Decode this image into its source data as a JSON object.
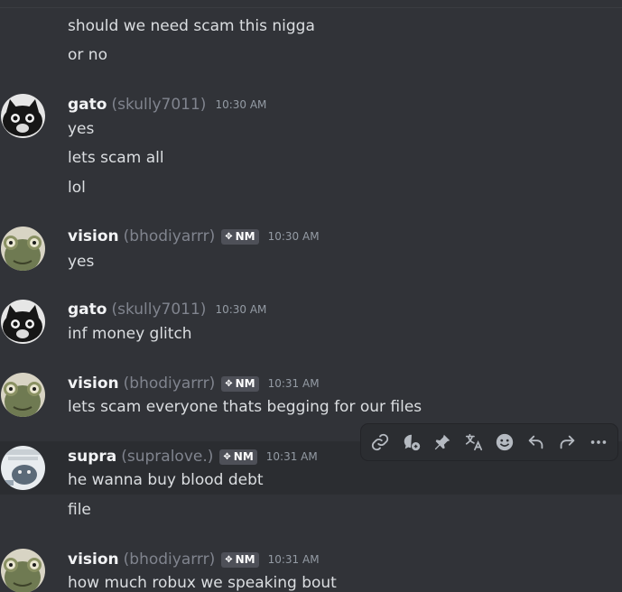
{
  "messages": {
    "m0": {
      "lines": [
        "should we need scam this nigga",
        "or no"
      ]
    },
    "m1": {
      "username": "gato",
      "handle": "(skully7011)",
      "time": "10:30 AM",
      "lines": [
        "yes",
        "lets scam all",
        "lol"
      ]
    },
    "m2": {
      "username": "vision",
      "handle": "(bhodiyarrr)",
      "tag": "NM",
      "time": "10:30 AM",
      "lines": [
        "yes"
      ]
    },
    "m3": {
      "username": "gato",
      "handle": "(skully7011)",
      "time": "10:30 AM",
      "lines": [
        "inf money glitch"
      ]
    },
    "m4": {
      "username": "vision",
      "handle": "(bhodiyarrr)",
      "tag": "NM",
      "time": "10:31 AM",
      "lines": [
        "lets scam everyone thats begging for our files"
      ]
    },
    "m5": {
      "username": "supra",
      "handle": "(supralove.)",
      "tag": "NM",
      "time": "10:31 AM",
      "lines": [
        "he wanna buy blood debt",
        "file"
      ]
    },
    "m6": {
      "username": "vision",
      "handle": "(bhodiyarrr)",
      "tag": "NM",
      "time": "10:31 AM",
      "lines": [
        "how much robux we speaking bout"
      ]
    }
  },
  "toolbar": {
    "icons": [
      "link-icon",
      "thread-icon",
      "pin-icon",
      "translate-icon",
      "emoji-icon",
      "reply-icon",
      "forward-icon",
      "more-icon"
    ]
  },
  "colors": {
    "background": "#313338",
    "hover_row": "#2b2d31",
    "username": "#f2f3f5",
    "handle": "#80848e",
    "timestamp": "#949ba4",
    "tag_bg": "#4e5058"
  }
}
